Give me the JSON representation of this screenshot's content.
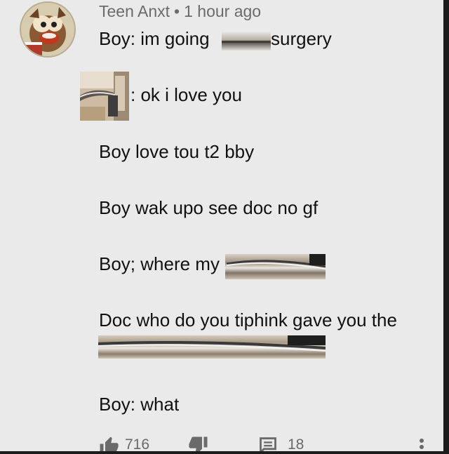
{
  "comment": {
    "author": "Teen Anxt",
    "separator": "•",
    "time": "1 hour ago",
    "lines": {
      "l1_prefix": "Boy: im going",
      "l1_suffix": "surgery",
      "l2": ": ok i love you",
      "l3": "Boy love tou t2 bby",
      "l4": "Boy wak upo see doc no gf",
      "l5": "Boy; where my",
      "l6": "Doc who do you tiphink gave you the",
      "l7": "Boy: what"
    }
  },
  "actions": {
    "like_count": "716",
    "reply_count": "18"
  },
  "icons": {
    "like": "thumbs-up-icon",
    "dislike": "thumbs-down-icon",
    "reply": "comment-icon",
    "more": "more-vertical-icon"
  },
  "colors": {
    "background": "#eaeaea",
    "meta_text": "#6b6b6b",
    "body_text": "#111111",
    "icon": "#6a6a6a"
  }
}
